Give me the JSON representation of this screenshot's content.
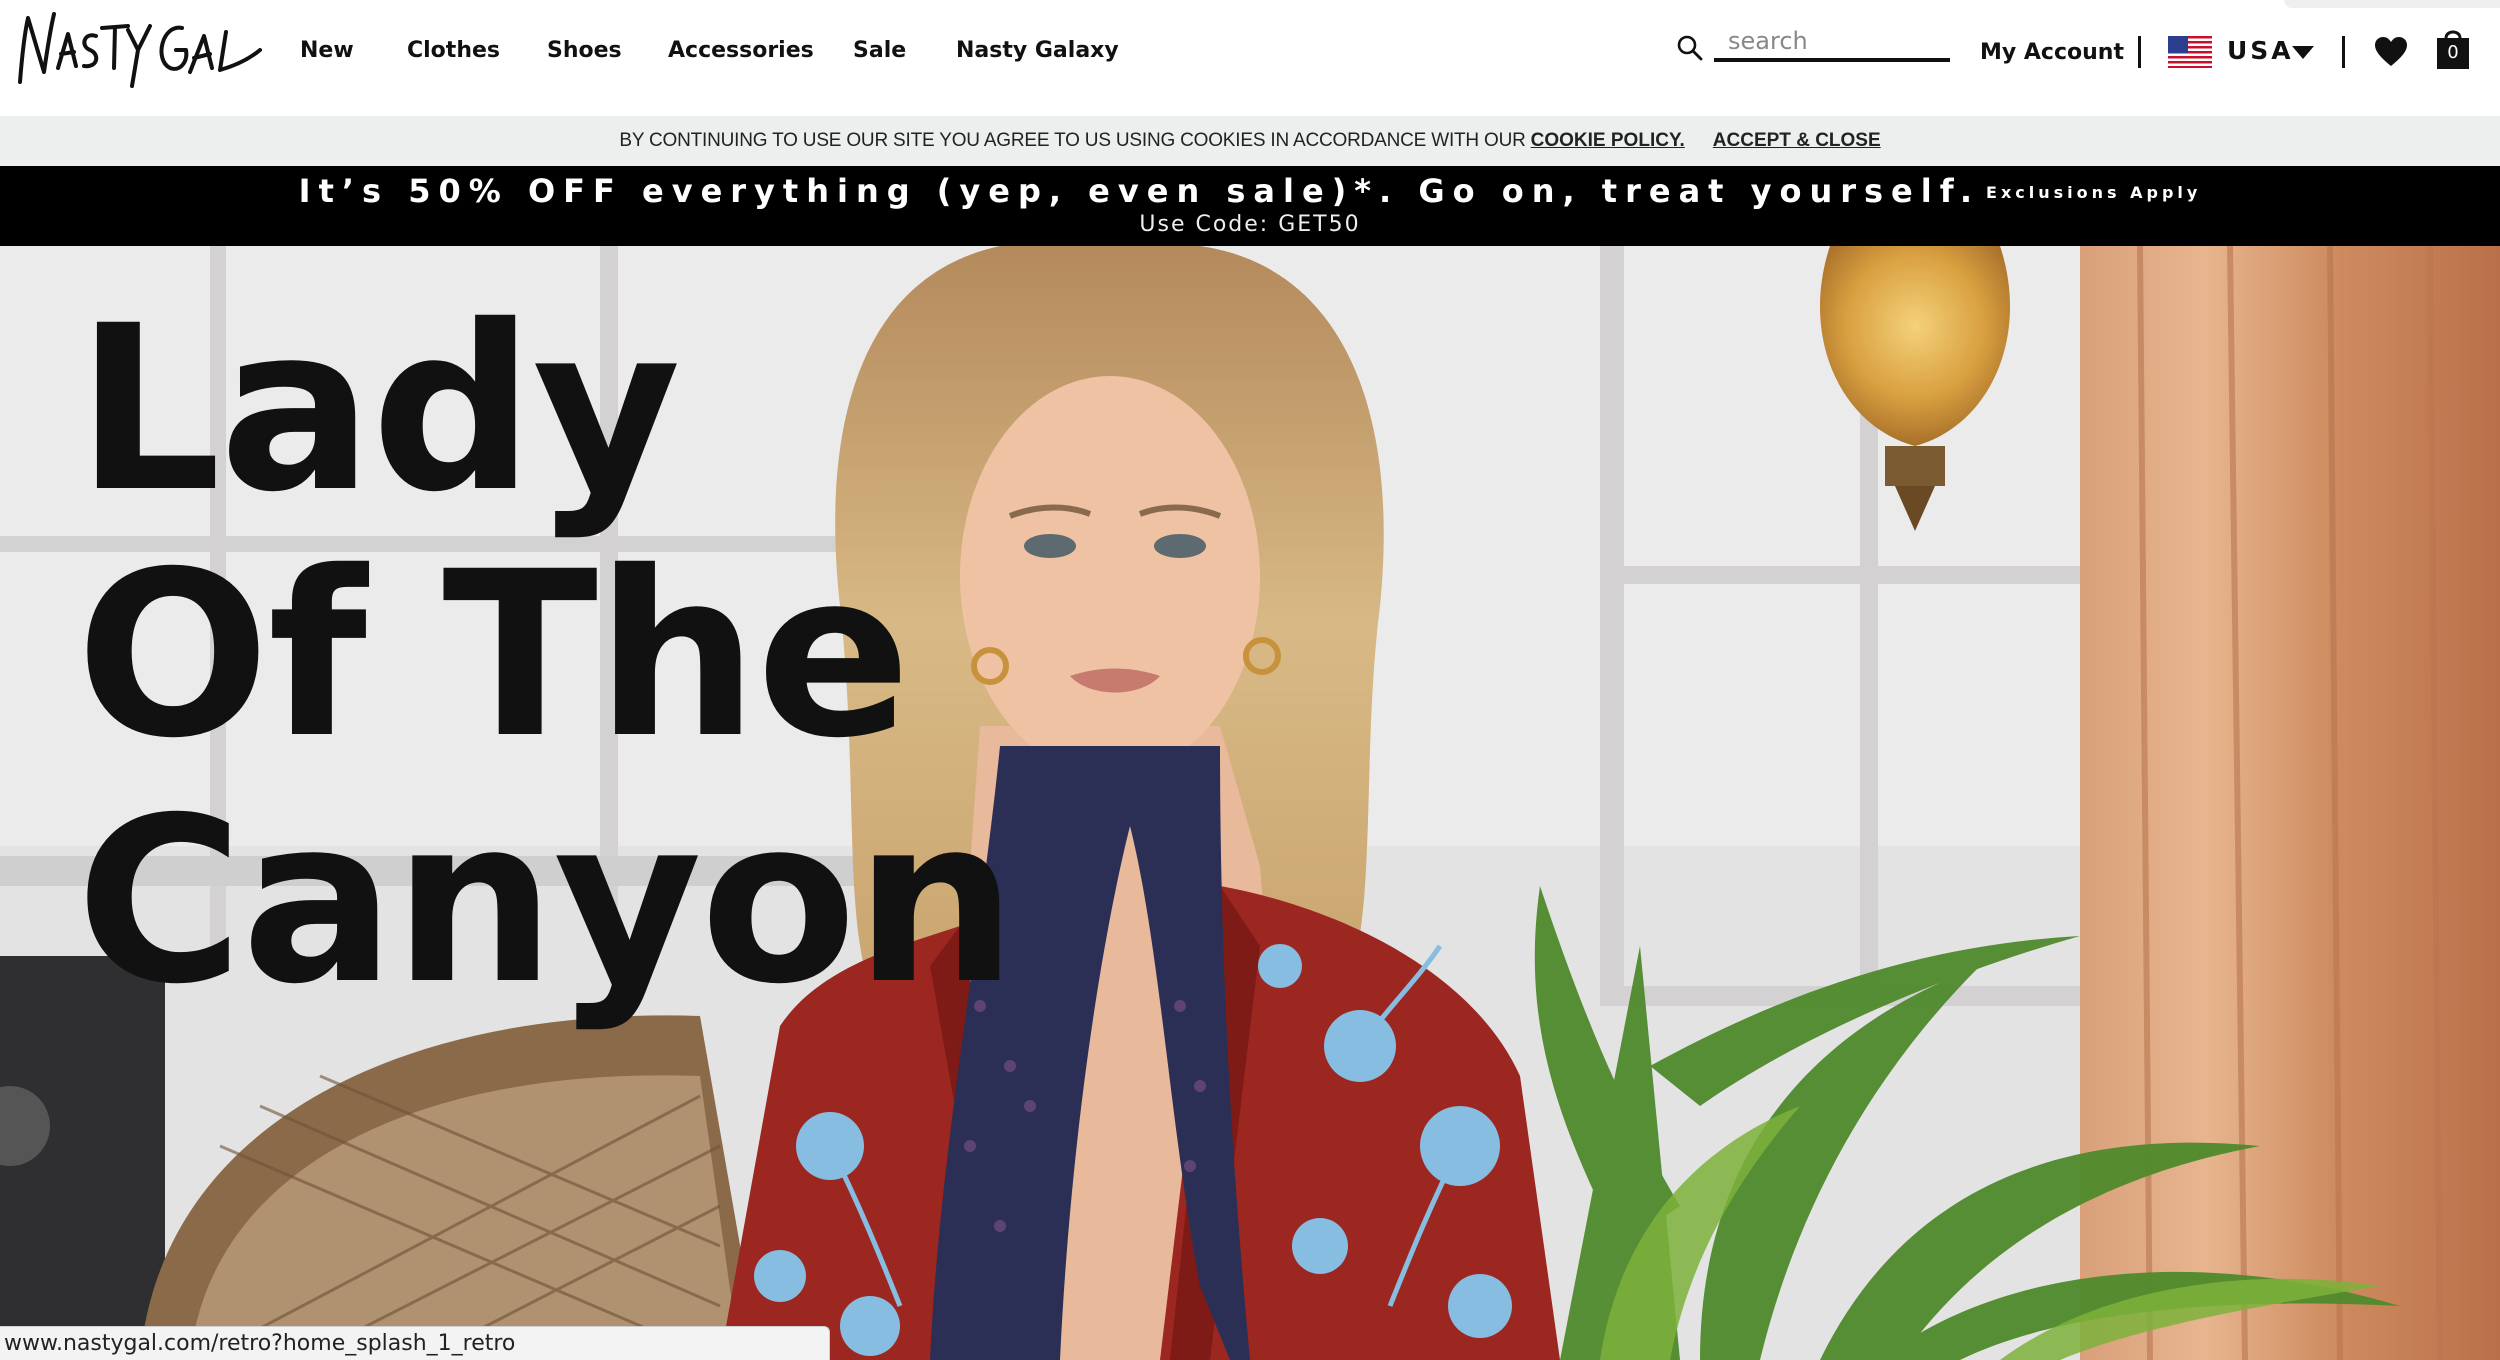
{
  "header": {
    "logo_text": "NASTY GAL",
    "nav": [
      "New",
      "Clothes",
      "Shoes",
      "Accessories",
      "Sale",
      "Nasty Galaxy"
    ],
    "search_placeholder": "search",
    "my_account": "My Account",
    "country": "USA",
    "bag_count": "0"
  },
  "cookie_bar": {
    "text": "BY CONTINUING TO USE OUR SITE YOU AGREE TO US USING COOKIES IN ACCORDANCE WITH OUR",
    "policy_link": "COOKIE POLICY.",
    "accept": "ACCEPT & CLOSE"
  },
  "promo": {
    "headline": "It’s 50% OFF everything (yep, even sale)*. Go on, treat yourself.",
    "exclusions": "Exclusions Apply",
    "code": "Use Code: GET50"
  },
  "hero": {
    "title_lines": [
      "Lady",
      "Of The",
      "Canyon"
    ]
  },
  "status_bar": {
    "url": "www.nastygal.com/retro?home_splash_1_retro"
  },
  "icons": [
    "logo",
    "search-icon",
    "flag-us-icon",
    "chevron-down-icon",
    "heart-icon",
    "shopping-bag-icon"
  ],
  "colors": {
    "promo_bg": "#000000",
    "cookie_bg": "#edeeee",
    "jacket_red": "#9c2620",
    "floral_blue": "#86bde0"
  }
}
